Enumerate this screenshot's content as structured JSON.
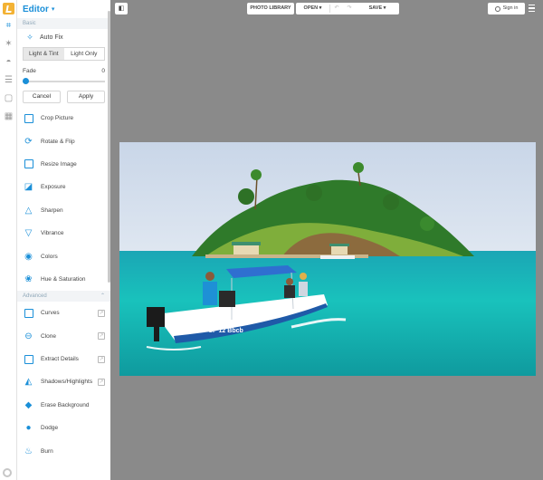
{
  "app": {
    "title": "Editor"
  },
  "panel": {
    "section_basic": "Basic",
    "auto_fix": "Auto Fix",
    "tabs": [
      "Light & Tint",
      "Light Only"
    ],
    "fade_label": "Fade",
    "fade_value": "0",
    "cancel": "Cancel",
    "apply": "Apply",
    "tools": [
      {
        "label": "Crop Picture",
        "icon": "crop-icon"
      },
      {
        "label": "Rotate & Flip",
        "icon": "rotate-icon"
      },
      {
        "label": "Resize Image",
        "icon": "resize-icon"
      },
      {
        "label": "Exposure",
        "icon": "exposure-icon"
      },
      {
        "label": "Sharpen",
        "icon": "sharpen-icon"
      },
      {
        "label": "Vibrance",
        "icon": "vibrance-icon"
      },
      {
        "label": "Colors",
        "icon": "colors-icon"
      },
      {
        "label": "Hue & Saturation",
        "icon": "hue-icon"
      }
    ],
    "section_advanced": "Advanced",
    "advanced_tools": [
      {
        "label": "Curves",
        "icon": "curves-icon",
        "locked": true
      },
      {
        "label": "Clone",
        "icon": "clone-icon",
        "locked": true
      },
      {
        "label": "Extract Details",
        "icon": "extract-details-icon",
        "locked": true
      },
      {
        "label": "Shadows/Highlights",
        "icon": "shadows-highlights-icon",
        "locked": true
      },
      {
        "label": "Erase Background",
        "icon": "erase-background-icon",
        "locked": false
      },
      {
        "label": "Dodge",
        "icon": "dodge-icon",
        "locked": false
      },
      {
        "label": "Burn",
        "icon": "burn-icon",
        "locked": false
      }
    ]
  },
  "topbar": {
    "photo_library": "PHOTO LIBRARY",
    "open": "OPEN",
    "save": "SAVE",
    "sign_in": "Sign in"
  },
  "colors": {
    "accent": "#1a8fd8",
    "workspace": "#8a8a8a",
    "logo": "#f3b234"
  },
  "photo": {
    "boat_text": "CP 12 Bbcb"
  }
}
